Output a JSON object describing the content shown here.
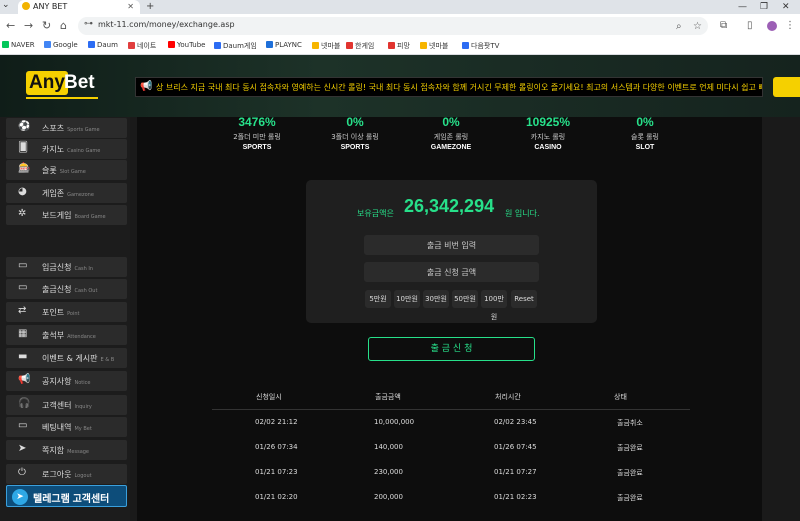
{
  "browser": {
    "tab_title": "ANY BET",
    "url": "mkt-11.com/money/exchange.asp",
    "bookmarks": [
      {
        "label": "NAVER",
        "color": "#03c75a"
      },
      {
        "label": "Google",
        "color": "#4285f4"
      },
      {
        "label": "Daum",
        "color": "#2c6cf3"
      },
      {
        "label": "네이트",
        "color": "#e13e3e"
      },
      {
        "label": "YouTube",
        "color": "#ff0000"
      },
      {
        "label": "Daum게임",
        "color": "#2c6cf3"
      },
      {
        "label": "PLAYNC",
        "color": "#1e6fd9"
      },
      {
        "label": "넷마블",
        "color": "#f7b500"
      },
      {
        "label": "한게임",
        "color": "#e1342f"
      },
      {
        "label": "피망",
        "color": "#e1342f"
      },
      {
        "label": "넷마블",
        "color": "#f7b500"
      },
      {
        "label": "다음팟TV",
        "color": "#2c6cf3"
      }
    ]
  },
  "site": {
    "logo_any": "Any",
    "logo_bet": "Bet",
    "notice": "상 브리스 지금 국내 최다 동시 접속자와 영예하는 신시간 롤링! 국내 최다 동시 접속자와 함께 거시긴 무제한 롤링이오 즐기세요! 최고의 서스템과 다양한 이벤트로 언제 미다시 쉽고 빠르게 접속 가능합"
  },
  "sidebar": {
    "items": [
      {
        "icon": "soccer-ball-icon",
        "glyph": "⚽",
        "label": "스포츠",
        "sub": "Sports Game"
      },
      {
        "icon": "cards-icon",
        "glyph": "🂠",
        "label": "카지노",
        "sub": "Casino Game"
      },
      {
        "icon": "slot-icon",
        "glyph": "🎰",
        "label": "슬롯",
        "sub": "Slot Game"
      },
      {
        "icon": "pacman-icon",
        "glyph": "◕",
        "label": "게임존",
        "sub": "Gamezone"
      },
      {
        "icon": "gear-icon",
        "glyph": "✲",
        "label": "보드게임",
        "sub": "Board Game"
      },
      {
        "icon": "cash-in-icon",
        "glyph": "▭",
        "label": "입금신청",
        "sub": "Cash In"
      },
      {
        "icon": "cash-out-icon",
        "glyph": "▭",
        "label": "출금신청",
        "sub": "Cash Out"
      },
      {
        "icon": "point-icon",
        "glyph": "⇄",
        "label": "포인트",
        "sub": "Point"
      },
      {
        "icon": "calendar-icon",
        "glyph": "▦",
        "label": "출석부",
        "sub": "Attendance"
      },
      {
        "icon": "event-icon",
        "glyph": "▬",
        "label": "이벤트 & 게시판",
        "sub": "E & B"
      },
      {
        "icon": "megaphone-icon",
        "glyph": "📢",
        "label": "공지사항",
        "sub": "Notice"
      },
      {
        "icon": "headset-icon",
        "glyph": "🎧",
        "label": "고객센터",
        "sub": "Inquiry"
      },
      {
        "icon": "ticket-icon",
        "glyph": "▭",
        "label": "베팅내역",
        "sub": "My Bet"
      },
      {
        "icon": "cursor-icon",
        "glyph": "➤",
        "label": "쪽지함",
        "sub": "Message"
      },
      {
        "icon": "power-icon",
        "glyph": "⏻",
        "label": "로그아웃",
        "sub": "Logout"
      }
    ],
    "telegram_label": "텔레그램 고객센터"
  },
  "stats": [
    {
      "value": "3476%",
      "label": "2폴더 미만 롤링",
      "name": "SPORTS"
    },
    {
      "value": "0%",
      "label": "3폴더 이상 롤링",
      "name": "SPORTS"
    },
    {
      "value": "0%",
      "label": "게임존 롤링",
      "name": "GAMEZONE"
    },
    {
      "value": "10925%",
      "label": "카지노 롤링",
      "name": "CASINO"
    },
    {
      "value": "0%",
      "label": "슬롯 롤링",
      "name": "SLOT"
    }
  ],
  "exchange": {
    "balance_label": "보유금액은",
    "balance_value": "26,342,294",
    "balance_suffix": "원 입니다.",
    "password_placeholder": "출금 비번 입력",
    "amount_placeholder": "출금 신청 금액",
    "amount_buttons": [
      "5만원",
      "10만원",
      "30만원",
      "50만원",
      "100만원",
      "Reset"
    ],
    "submit_label": "출 금 신 청"
  },
  "history": {
    "columns": [
      "신청일시",
      "출금금액",
      "처리시간",
      "상태"
    ],
    "rows": [
      {
        "date": "02/02 21:12",
        "amount": "10,000,000",
        "processed": "02/02 23:45",
        "status": "출금취소"
      },
      {
        "date": "01/26 07:34",
        "amount": "140,000",
        "processed": "01/26 07:45",
        "status": "출금완료"
      },
      {
        "date": "01/21 07:23",
        "amount": "230,000",
        "processed": "01/21 07:27",
        "status": "출금완료"
      },
      {
        "date": "01/21 02:20",
        "amount": "200,000",
        "processed": "01/21 02:23",
        "status": "출금완료"
      }
    ]
  }
}
